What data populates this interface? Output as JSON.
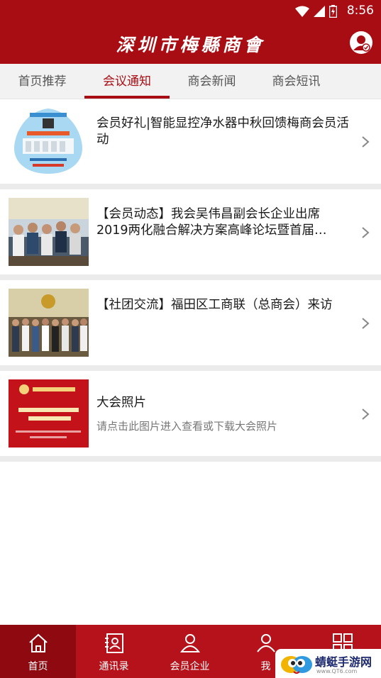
{
  "status_bar": {
    "time": "8:56"
  },
  "header": {
    "title": "深圳市梅縣商會",
    "profile_icon": "user-profile-icon"
  },
  "tabs": [
    {
      "label": "首页推荐"
    },
    {
      "label": "会议通知"
    },
    {
      "label": "商会新闻"
    },
    {
      "label": "商会短讯"
    }
  ],
  "active_tab": "会议通知",
  "list": [
    {
      "title": "会员好礼|智能显控净水器中秋回馈梅商会员活动",
      "subtitle": ""
    },
    {
      "title": "【会员动态】我会吴伟昌副会长企业出席2019两化融合解决方案高峰论坛暨首届…",
      "subtitle": ""
    },
    {
      "title": "【社团交流】福田区工商联（总商会）来访",
      "subtitle": ""
    },
    {
      "title": "大会照片",
      "subtitle": "请点击此图片进入查看或下载大会照片"
    }
  ],
  "bottom_nav": [
    {
      "label": "首页",
      "icon": "home-icon"
    },
    {
      "label": "通讯录",
      "icon": "contacts-icon"
    },
    {
      "label": "会员企业",
      "icon": "member-enterprise-icon"
    },
    {
      "label": "我",
      "icon": "me-icon"
    },
    {
      "label": "",
      "icon": "grid-apps-icon"
    }
  ],
  "watermark": {
    "text": "蜻蜓手游网",
    "sub": "www.QT6.com"
  },
  "colors": {
    "brand_red": "#a80d14",
    "nav_red": "#b5121b",
    "active_nav": "#8e0a10"
  }
}
